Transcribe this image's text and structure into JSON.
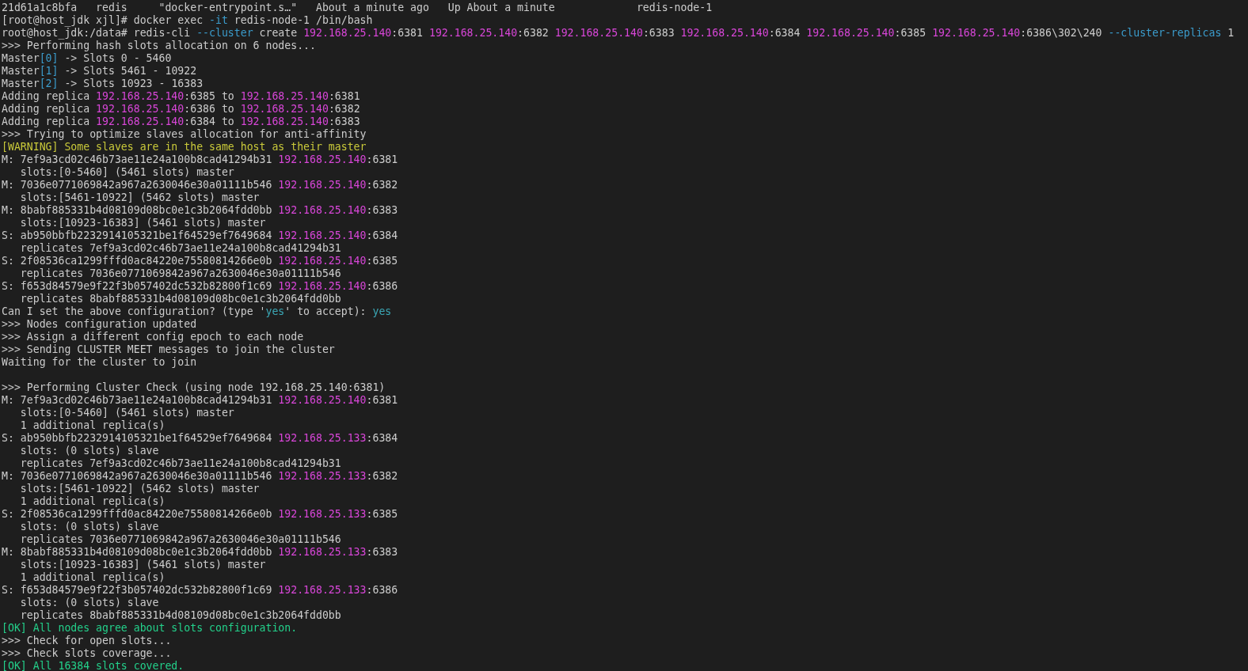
{
  "terminal": {
    "lines": [
      {
        "kind": "text",
        "segments": [
          {
            "text": "21d61a1c8bfa   redis     \"docker-entrypoint.s…\"   About a minute ago   Up About a minute             redis-node-1",
            "color": "#cccccc"
          }
        ]
      },
      {
        "kind": "text",
        "segments": [
          {
            "text": "[root@host_jdk xjl]# docker exec ",
            "color": "#cccccc"
          },
          {
            "text": "-it",
            "color": "#3b9ccc"
          },
          {
            "text": " redis-node-1 /bin/bash",
            "color": "#cccccc"
          }
        ]
      },
      {
        "kind": "text",
        "segments": [
          {
            "text": "root@host_jdk:/data# redis-cli ",
            "color": "#cccccc"
          },
          {
            "text": "--cluster",
            "color": "#3b9ccc"
          },
          {
            "text": " create ",
            "color": "#cccccc"
          },
          {
            "text": "192.168.25.140",
            "color": "#d846d8"
          },
          {
            "text": ":6381 ",
            "color": "#cccccc"
          },
          {
            "text": "192.168.25.140",
            "color": "#d846d8"
          },
          {
            "text": ":6382 ",
            "color": "#cccccc"
          },
          {
            "text": "192.168.25.140",
            "color": "#d846d8"
          },
          {
            "text": ":6383 ",
            "color": "#cccccc"
          },
          {
            "text": "192.168.25.140",
            "color": "#d846d8"
          },
          {
            "text": ":6384 ",
            "color": "#cccccc"
          },
          {
            "text": "192.168.25.140",
            "color": "#d846d8"
          },
          {
            "text": ":6385 ",
            "color": "#cccccc"
          },
          {
            "text": "192.168.25.140",
            "color": "#d846d8"
          },
          {
            "text": ":6386\\302\\240 ",
            "color": "#cccccc"
          },
          {
            "text": "--cluster-replicas",
            "color": "#3b9ccc"
          },
          {
            "text": " 1",
            "color": "#cccccc"
          }
        ]
      },
      {
        "kind": "text",
        "segments": [
          {
            "text": ">>> Performing hash slots allocation on 6 nodes...",
            "color": "#cccccc"
          }
        ]
      },
      {
        "kind": "text",
        "segments": [
          {
            "text": "Master",
            "color": "#cccccc"
          },
          {
            "text": "[0]",
            "color": "#3b9ccc"
          },
          {
            "text": " -> Slots 0 - 5460",
            "color": "#cccccc"
          }
        ]
      },
      {
        "kind": "text",
        "segments": [
          {
            "text": "Master",
            "color": "#cccccc"
          },
          {
            "text": "[1]",
            "color": "#3b9ccc"
          },
          {
            "text": " -> Slots 5461 - 10922",
            "color": "#cccccc"
          }
        ]
      },
      {
        "kind": "text",
        "segments": [
          {
            "text": "Master",
            "color": "#cccccc"
          },
          {
            "text": "[2]",
            "color": "#3b9ccc"
          },
          {
            "text": " -> Slots 10923 - 16383",
            "color": "#cccccc"
          }
        ]
      },
      {
        "kind": "text",
        "segments": [
          {
            "text": "Adding replica ",
            "color": "#cccccc"
          },
          {
            "text": "192.168.25.140",
            "color": "#d846d8"
          },
          {
            "text": ":6385 to ",
            "color": "#cccccc"
          },
          {
            "text": "192.168.25.140",
            "color": "#d846d8"
          },
          {
            "text": ":6381",
            "color": "#cccccc"
          }
        ]
      },
      {
        "kind": "text",
        "segments": [
          {
            "text": "Adding replica ",
            "color": "#cccccc"
          },
          {
            "text": "192.168.25.140",
            "color": "#d846d8"
          },
          {
            "text": ":6386 to ",
            "color": "#cccccc"
          },
          {
            "text": "192.168.25.140",
            "color": "#d846d8"
          },
          {
            "text": ":6382",
            "color": "#cccccc"
          }
        ]
      },
      {
        "kind": "text",
        "segments": [
          {
            "text": "Adding replica ",
            "color": "#cccccc"
          },
          {
            "text": "192.168.25.140",
            "color": "#d846d8"
          },
          {
            "text": ":6384 to ",
            "color": "#cccccc"
          },
          {
            "text": "192.168.25.140",
            "color": "#d846d8"
          },
          {
            "text": ":6383",
            "color": "#cccccc"
          }
        ]
      },
      {
        "kind": "text",
        "segments": [
          {
            "text": ">>> Trying to optimize slaves allocation for anti-affinity",
            "color": "#cccccc"
          }
        ]
      },
      {
        "kind": "text",
        "segments": [
          {
            "text": "[WARNING] Some slaves are in the same host as their master",
            "color": "#c9c93a"
          }
        ]
      },
      {
        "kind": "text",
        "segments": [
          {
            "text": "M: 7ef9a3cd02c46b73ae11e24a100b8cad41294b31 ",
            "color": "#cccccc"
          },
          {
            "text": "192.168.25.140",
            "color": "#d846d8"
          },
          {
            "text": ":6381",
            "color": "#cccccc"
          }
        ]
      },
      {
        "kind": "text",
        "segments": [
          {
            "text": "   slots:[0-5460] (5461 slots) master",
            "color": "#cccccc"
          }
        ]
      },
      {
        "kind": "text",
        "segments": [
          {
            "text": "M: 7036e0771069842a967a2630046e30a01111b546 ",
            "color": "#cccccc"
          },
          {
            "text": "192.168.25.140",
            "color": "#d846d8"
          },
          {
            "text": ":6382",
            "color": "#cccccc"
          }
        ]
      },
      {
        "kind": "text",
        "segments": [
          {
            "text": "   slots:[5461-10922] (5462 slots) master",
            "color": "#cccccc"
          }
        ]
      },
      {
        "kind": "text",
        "segments": [
          {
            "text": "M: 8babf885331b4d08109d08bc0e1c3b2064fdd0bb ",
            "color": "#cccccc"
          },
          {
            "text": "192.168.25.140",
            "color": "#d846d8"
          },
          {
            "text": ":6383",
            "color": "#cccccc"
          }
        ]
      },
      {
        "kind": "text",
        "segments": [
          {
            "text": "   slots:[10923-16383] (5461 slots) master",
            "color": "#cccccc"
          }
        ]
      },
      {
        "kind": "text",
        "segments": [
          {
            "text": "S: ab950bbfb2232914105321be1f64529ef7649684 ",
            "color": "#cccccc"
          },
          {
            "text": "192.168.25.140",
            "color": "#d846d8"
          },
          {
            "text": ":6384",
            "color": "#cccccc"
          }
        ]
      },
      {
        "kind": "text",
        "segments": [
          {
            "text": "   replicates 7ef9a3cd02c46b73ae11e24a100b8cad41294b31",
            "color": "#cccccc"
          }
        ]
      },
      {
        "kind": "text",
        "segments": [
          {
            "text": "S: 2f08536ca1299fffd0ac84220e75580814266e0b ",
            "color": "#cccccc"
          },
          {
            "text": "192.168.25.140",
            "color": "#d846d8"
          },
          {
            "text": ":6385",
            "color": "#cccccc"
          }
        ]
      },
      {
        "kind": "text",
        "segments": [
          {
            "text": "   replicates 7036e0771069842a967a2630046e30a01111b546",
            "color": "#cccccc"
          }
        ]
      },
      {
        "kind": "text",
        "segments": [
          {
            "text": "S: f653d84579e9f22f3b057402dc532b82800f1c69 ",
            "color": "#cccccc"
          },
          {
            "text": "192.168.25.140",
            "color": "#d846d8"
          },
          {
            "text": ":6386",
            "color": "#cccccc"
          }
        ]
      },
      {
        "kind": "text",
        "segments": [
          {
            "text": "   replicates 8babf885331b4d08109d08bc0e1c3b2064fdd0bb",
            "color": "#cccccc"
          }
        ]
      },
      {
        "kind": "text",
        "segments": [
          {
            "text": "Can I set the above configuration? (type '",
            "color": "#cccccc"
          },
          {
            "text": "yes",
            "color": "#3ba7b5"
          },
          {
            "text": "' to accept): ",
            "color": "#cccccc"
          },
          {
            "text": "yes",
            "color": "#3ba7b5"
          }
        ]
      },
      {
        "kind": "text",
        "segments": [
          {
            "text": ">>> Nodes configuration updated",
            "color": "#cccccc"
          }
        ]
      },
      {
        "kind": "text",
        "segments": [
          {
            "text": ">>> Assign a different config epoch to each node",
            "color": "#cccccc"
          }
        ]
      },
      {
        "kind": "text",
        "segments": [
          {
            "text": ">>> Sending CLUSTER MEET messages to join the cluster",
            "color": "#cccccc"
          }
        ]
      },
      {
        "kind": "text",
        "segments": [
          {
            "text": "Waiting for the cluster to join",
            "color": "#cccccc"
          }
        ]
      },
      {
        "kind": "blank"
      },
      {
        "kind": "text",
        "segments": [
          {
            "text": ">>> Performing Cluster Check (using node 192.168.25.140:6381)",
            "color": "#cccccc"
          }
        ]
      },
      {
        "kind": "text",
        "segments": [
          {
            "text": "M: 7ef9a3cd02c46b73ae11e24a100b8cad41294b31 ",
            "color": "#cccccc"
          },
          {
            "text": "192.168.25.140",
            "color": "#d846d8"
          },
          {
            "text": ":6381",
            "color": "#cccccc"
          }
        ]
      },
      {
        "kind": "text",
        "segments": [
          {
            "text": "   slots:[0-5460] (5461 slots) master",
            "color": "#cccccc"
          }
        ]
      },
      {
        "kind": "text",
        "segments": [
          {
            "text": "   1 additional replica(s)",
            "color": "#cccccc"
          }
        ]
      },
      {
        "kind": "text",
        "segments": [
          {
            "text": "S: ab950bbfb2232914105321be1f64529ef7649684 ",
            "color": "#cccccc"
          },
          {
            "text": "192.168.25.133",
            "color": "#d846d8"
          },
          {
            "text": ":6384",
            "color": "#cccccc"
          }
        ]
      },
      {
        "kind": "text",
        "segments": [
          {
            "text": "   slots: (0 slots) slave",
            "color": "#cccccc"
          }
        ]
      },
      {
        "kind": "text",
        "segments": [
          {
            "text": "   replicates 7ef9a3cd02c46b73ae11e24a100b8cad41294b31",
            "color": "#cccccc"
          }
        ]
      },
      {
        "kind": "text",
        "segments": [
          {
            "text": "M: 7036e0771069842a967a2630046e30a01111b546 ",
            "color": "#cccccc"
          },
          {
            "text": "192.168.25.133",
            "color": "#d846d8"
          },
          {
            "text": ":6382",
            "color": "#cccccc"
          }
        ]
      },
      {
        "kind": "text",
        "segments": [
          {
            "text": "   slots:[5461-10922] (5462 slots) master",
            "color": "#cccccc"
          }
        ]
      },
      {
        "kind": "text",
        "segments": [
          {
            "text": "   1 additional replica(s)",
            "color": "#cccccc"
          }
        ]
      },
      {
        "kind": "text",
        "segments": [
          {
            "text": "S: 2f08536ca1299fffd0ac84220e75580814266e0b ",
            "color": "#cccccc"
          },
          {
            "text": "192.168.25.133",
            "color": "#d846d8"
          },
          {
            "text": ":6385",
            "color": "#cccccc"
          }
        ]
      },
      {
        "kind": "text",
        "segments": [
          {
            "text": "   slots: (0 slots) slave",
            "color": "#cccccc"
          }
        ]
      },
      {
        "kind": "text",
        "segments": [
          {
            "text": "   replicates 7036e0771069842a967a2630046e30a01111b546",
            "color": "#cccccc"
          }
        ]
      },
      {
        "kind": "text",
        "segments": [
          {
            "text": "M: 8babf885331b4d08109d08bc0e1c3b2064fdd0bb ",
            "color": "#cccccc"
          },
          {
            "text": "192.168.25.133",
            "color": "#d846d8"
          },
          {
            "text": ":6383",
            "color": "#cccccc"
          }
        ]
      },
      {
        "kind": "text",
        "segments": [
          {
            "text": "   slots:[10923-16383] (5461 slots) master",
            "color": "#cccccc"
          }
        ]
      },
      {
        "kind": "text",
        "segments": [
          {
            "text": "   1 additional replica(s)",
            "color": "#cccccc"
          }
        ]
      },
      {
        "kind": "text",
        "segments": [
          {
            "text": "S: f653d84579e9f22f3b057402dc532b82800f1c69 ",
            "color": "#cccccc"
          },
          {
            "text": "192.168.25.133",
            "color": "#d846d8"
          },
          {
            "text": ":6386",
            "color": "#cccccc"
          }
        ]
      },
      {
        "kind": "text",
        "segments": [
          {
            "text": "   slots: (0 slots) slave",
            "color": "#cccccc"
          }
        ]
      },
      {
        "kind": "text",
        "segments": [
          {
            "text": "   replicates 8babf885331b4d08109d08bc0e1c3b2064fdd0bb",
            "color": "#cccccc"
          }
        ]
      },
      {
        "kind": "text",
        "segments": [
          {
            "text": "[OK] All nodes agree about slots configuration.",
            "color": "#23d18b"
          }
        ]
      },
      {
        "kind": "text",
        "segments": [
          {
            "text": ">>> Check for open slots...",
            "color": "#cccccc"
          }
        ]
      },
      {
        "kind": "text",
        "segments": [
          {
            "text": ">>> Check slots coverage...",
            "color": "#cccccc"
          }
        ]
      },
      {
        "kind": "text",
        "segments": [
          {
            "text": "[OK] All 16384 slots covered.",
            "color": "#23d18b"
          }
        ]
      }
    ]
  }
}
